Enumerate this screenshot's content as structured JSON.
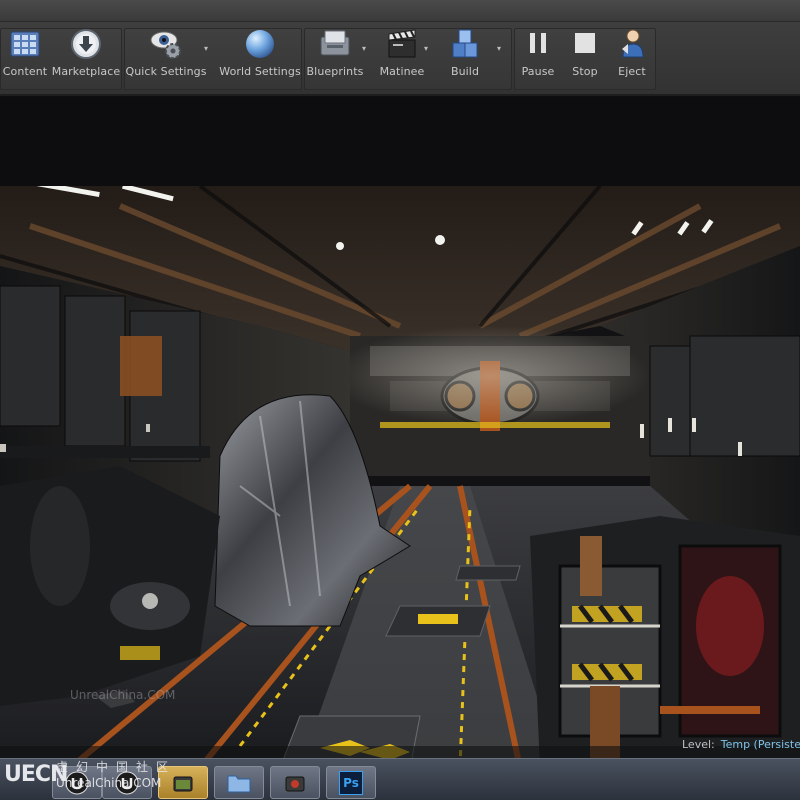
{
  "toolbar": {
    "content": "Content",
    "marketplace": "Marketplace",
    "quick_settings": "Quick Settings",
    "world_settings": "World Settings",
    "blueprints": "Blueprints",
    "matinee": "Matinee",
    "build": "Build",
    "pause": "Pause",
    "stop": "Stop",
    "eject": "Eject"
  },
  "viewport": {
    "watermark": "UnrealChina.COM",
    "level_label": "Level:",
    "level_value": "Temp (Persistent)"
  },
  "watermark": {
    "logo": "UECN",
    "chinese": "虚幻中国社区",
    "url": "UnrealChina.COM"
  },
  "taskbar": {
    "photoshop": "Ps"
  },
  "colors": {
    "toolbar_bg": "#363636",
    "label": "#c8c8c8",
    "level_value": "#7ec3ea",
    "hazard_yellow": "#e8c21a",
    "rust_orange": "#a8521e"
  }
}
